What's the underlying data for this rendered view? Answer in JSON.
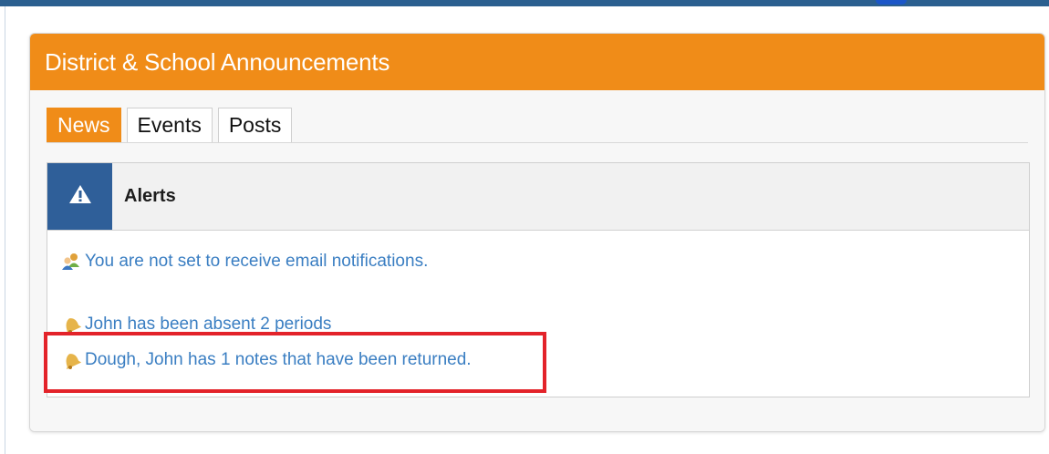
{
  "panel": {
    "title": "District & School Announcements",
    "header_color": "#f08c18"
  },
  "tabs": [
    {
      "label": "News",
      "active": true
    },
    {
      "label": "Events",
      "active": false
    },
    {
      "label": "Posts",
      "active": false
    }
  ],
  "alerts": {
    "title": "Alerts",
    "icon": "warning-icon",
    "icon_bg_color": "#2f5f99",
    "items": [
      {
        "icon": "users-icon",
        "text": "You are not set to receive email notifications."
      },
      {
        "icon": "bell-icon",
        "text": "John has been absent 2 periods"
      },
      {
        "icon": "bell-icon",
        "text": "Dough, John has 1 notes that have been returned."
      }
    ]
  },
  "highlight_color": "#e3232a",
  "link_color": "#3a7ec2"
}
